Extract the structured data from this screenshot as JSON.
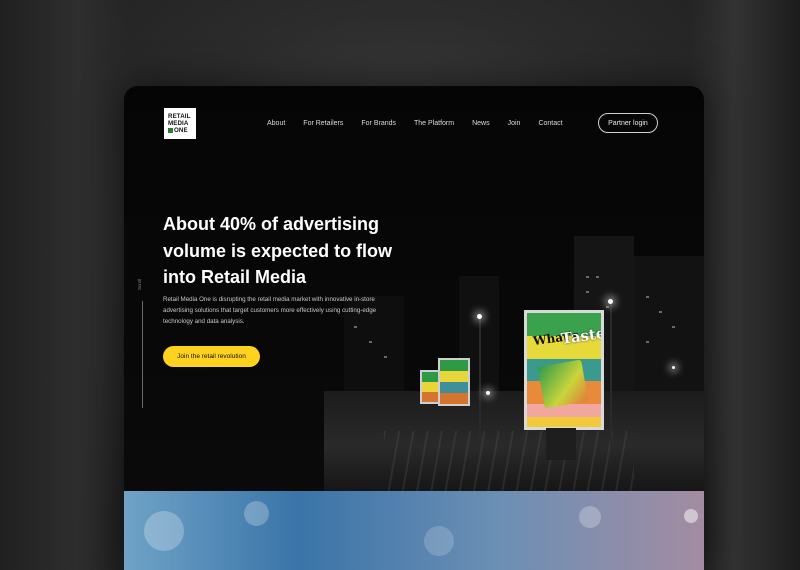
{
  "brand": {
    "logo_lines": [
      "RETAIL",
      "MEDIA",
      "ONE"
    ],
    "logo_accent": "#2a7a3a"
  },
  "nav": {
    "items": [
      "About",
      "For Retailers",
      "For Brands",
      "The Platform",
      "News",
      "Join",
      "Contact"
    ],
    "login_label": "Partner login"
  },
  "hero": {
    "headline": "About 40% of advertising volume is expected to flow into Retail Media",
    "description": "Retail Media One is disrupting the retail media market with innovative in-store advertising solutions that target customers more effectively using cutting-edge technology and data analysis.",
    "cta_label": "Join the retail revolution",
    "scroll_label": "Scroll",
    "cta_color": "#ffd21f"
  },
  "billboard": {
    "text_a": "What's",
    "text_b": "Taste"
  }
}
